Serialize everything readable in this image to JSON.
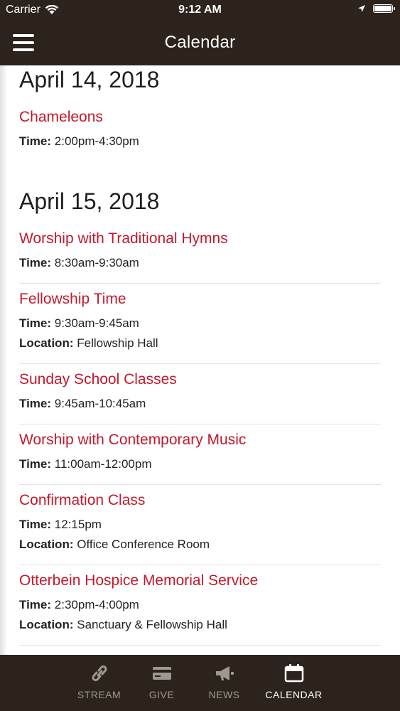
{
  "status": {
    "carrier": "Carrier",
    "time": "9:12 AM"
  },
  "nav": {
    "title": "Calendar"
  },
  "days": [
    {
      "date": "April 14, 2018",
      "events": [
        {
          "title": "Chameleons",
          "time": "2:00pm-4:30pm"
        }
      ]
    },
    {
      "date": "April 15, 2018",
      "events": [
        {
          "title": "Worship with Traditional Hymns",
          "time": "8:30am-9:30am"
        },
        {
          "title": "Fellowship Time",
          "time": "9:30am-9:45am",
          "location": "Fellowship Hall"
        },
        {
          "title": "Sunday School Classes",
          "time": "9:45am-10:45am"
        },
        {
          "title": "Worship with Contemporary Music",
          "time": "11:00am-12:00pm"
        },
        {
          "title": "Confirmation Class",
          "time": "12:15pm",
          "location": "Office Conference Room"
        },
        {
          "title": "Otterbein Hospice Memorial Service",
          "time": "2:30pm-4:00pm",
          "location": "Sanctuary & Fellowship Hall"
        }
      ]
    }
  ],
  "labels": {
    "time": "Time:",
    "location": "Location:"
  },
  "tabs": [
    {
      "label": "STREAM",
      "icon": "link-icon"
    },
    {
      "label": "GIVE",
      "icon": "credit-card-icon"
    },
    {
      "label": "NEWS",
      "icon": "megaphone-icon"
    },
    {
      "label": "CALENDAR",
      "icon": "calendar-icon",
      "active": true
    }
  ],
  "colors": {
    "bar": "#2b231c",
    "accent": "#c4182b",
    "tab_inactive": "#9e9892",
    "tab_active": "#ffffff"
  }
}
